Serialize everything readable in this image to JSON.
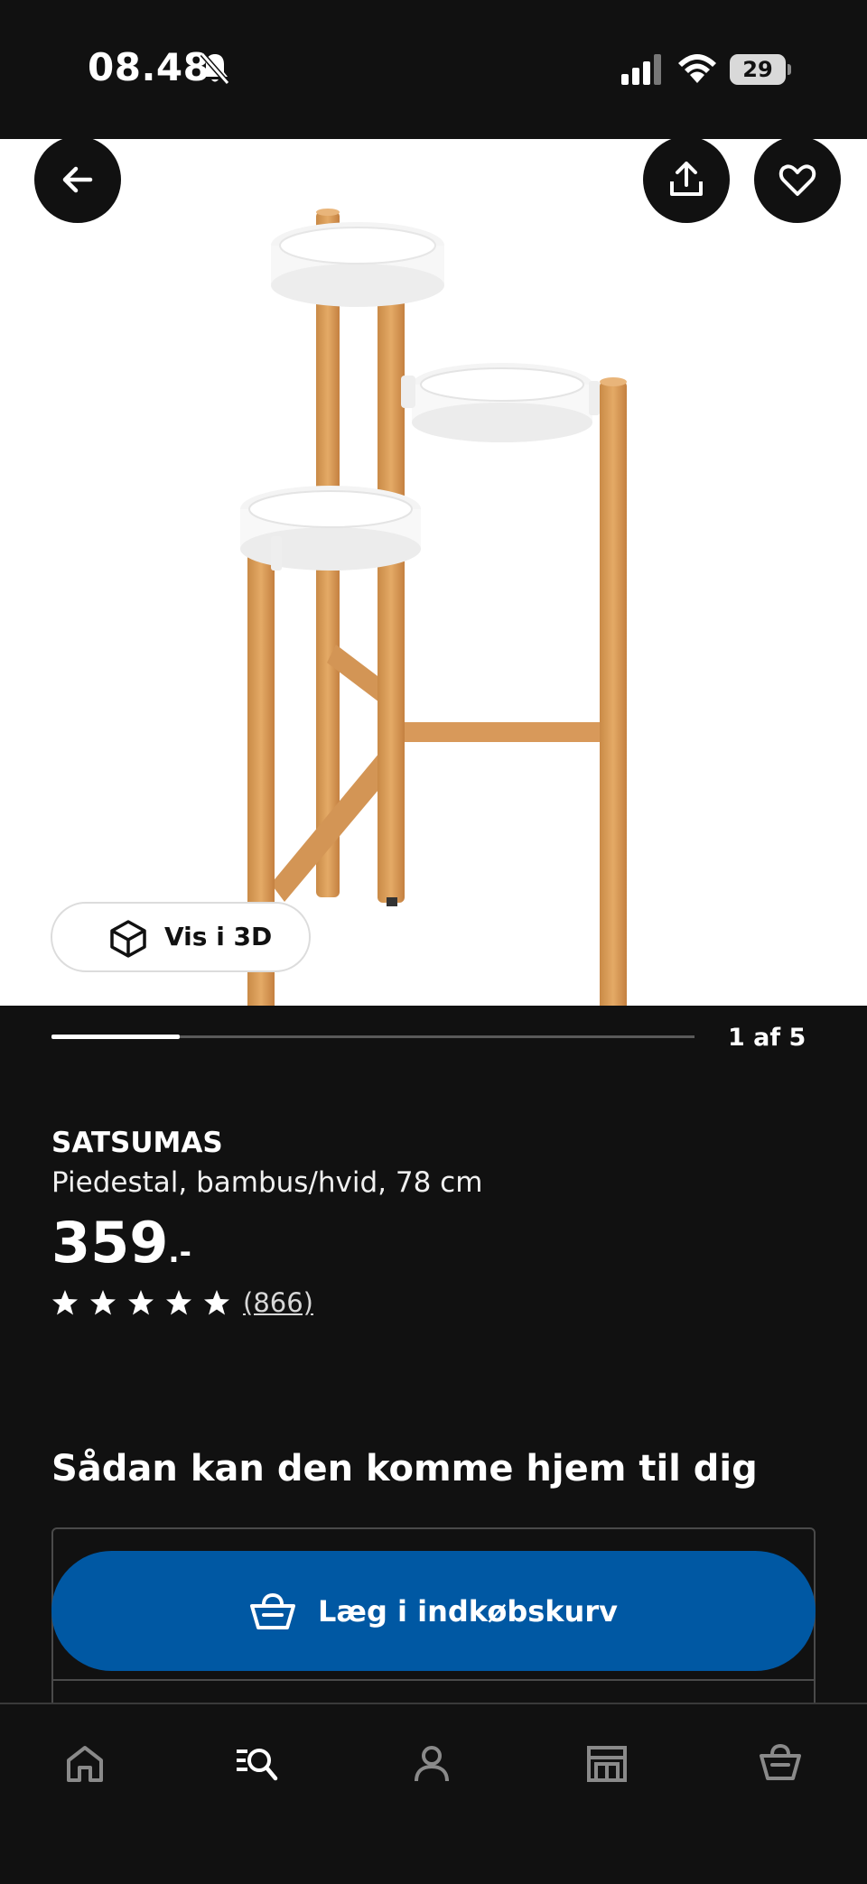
{
  "status_bar": {
    "time": "08.48",
    "battery": "29",
    "icons": [
      "bell-slash-icon",
      "signal-icon",
      "wifi-icon",
      "battery-icon"
    ]
  },
  "hero": {
    "buttons": {
      "back": "arrow-left-icon",
      "share": "share-icon",
      "favorite": "heart-icon"
    },
    "view_3d_label": "Vis i 3D",
    "view_3d_icon": "cube-icon"
  },
  "carousel": {
    "counter": "1 af 5",
    "progress": 0.2
  },
  "product": {
    "name": "SATSUMAS",
    "description": "Piedestal, bambus/hvid, 78 cm",
    "price": "359",
    "price_suffix": ".-",
    "rating_stars": 5,
    "review_count": "(866)"
  },
  "delivery": {
    "heading": "Sådan kan den komme hjem til dig",
    "add_to_cart_label": "Læg i indkøbskurv",
    "button_color": "#0058a3"
  },
  "bottom_nav": {
    "items": [
      "home-icon",
      "search-icon",
      "profile-icon",
      "store-icon",
      "cart-icon"
    ]
  }
}
